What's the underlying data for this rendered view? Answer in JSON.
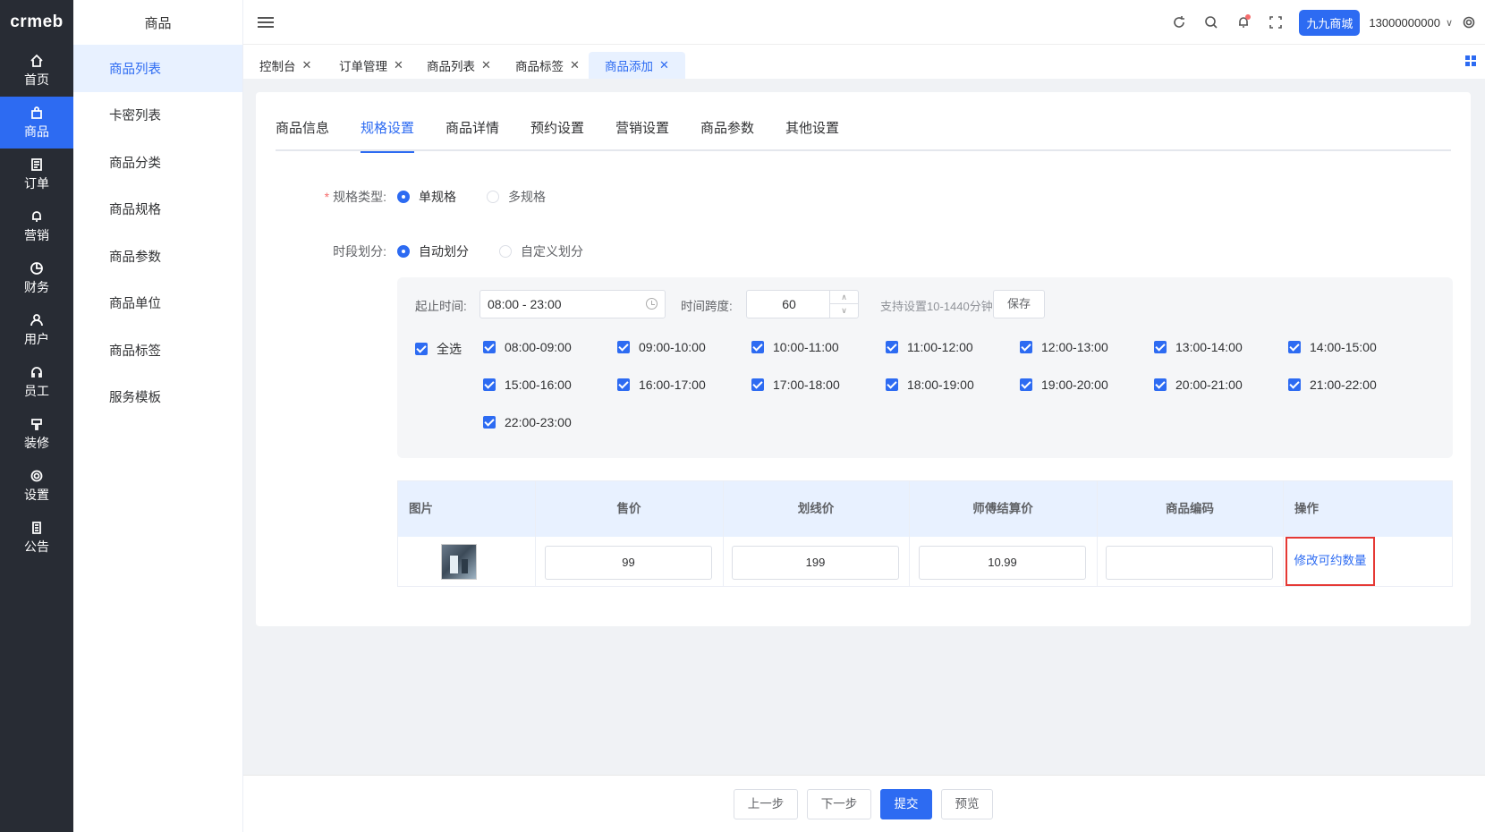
{
  "logo": "crmeb",
  "nav": [
    {
      "label": "首页",
      "icon": "home-icon"
    },
    {
      "label": "商品",
      "icon": "bag-icon"
    },
    {
      "label": "订单",
      "icon": "document-icon"
    },
    {
      "label": "营销",
      "icon": "bell-icon"
    },
    {
      "label": "财务",
      "icon": "pie-icon"
    },
    {
      "label": "用户",
      "icon": "user-icon"
    },
    {
      "label": "员工",
      "icon": "headset-icon"
    },
    {
      "label": "装修",
      "icon": "brush-icon"
    },
    {
      "label": "设置",
      "icon": "gear-icon"
    },
    {
      "label": "公告",
      "icon": "notice-icon"
    }
  ],
  "sidebar": {
    "title": "商品",
    "items": [
      "商品列表",
      "卡密列表",
      "商品分类",
      "商品规格",
      "商品参数",
      "商品单位",
      "商品标签",
      "服务模板"
    ]
  },
  "header": {
    "shop": "九九商城",
    "phone": "13000000000"
  },
  "tabs": [
    "控制台",
    "订单管理",
    "商品列表",
    "商品标签",
    "商品添加"
  ],
  "content_tabs": [
    "商品信息",
    "规格设置",
    "商品详情",
    "预约设置",
    "营销设置",
    "商品参数",
    "其他设置"
  ],
  "form": {
    "spec_type_label": "规格类型:",
    "spec_type_required": "*",
    "spec_options": [
      "单规格",
      "多规格"
    ],
    "period_label": "时段划分:",
    "period_options": [
      "自动划分",
      "自定义划分"
    ],
    "start_end_label": "起止时间:",
    "start_end_value": "08:00 - 23:00",
    "span_label": "时间跨度:",
    "span_value": "60",
    "span_hint": "支持设置10-1440分钟",
    "save": "保存",
    "select_all": "全选",
    "slots": [
      "08:00-09:00",
      "09:00-10:00",
      "10:00-11:00",
      "11:00-12:00",
      "12:00-13:00",
      "13:00-14:00",
      "14:00-15:00",
      "15:00-16:00",
      "16:00-17:00",
      "17:00-18:00",
      "18:00-19:00",
      "19:00-20:00",
      "20:00-21:00",
      "21:00-22:00",
      "22:00-23:00"
    ]
  },
  "table": {
    "headers": [
      "图片",
      "售价",
      "划线价",
      "师傅结算价",
      "商品编码",
      "操作"
    ],
    "row": {
      "price": "99",
      "line_price": "199",
      "settle_price": "10.99",
      "code": "",
      "action": "修改可约数量"
    }
  },
  "footer": {
    "prev": "上一步",
    "next": "下一步",
    "submit": "提交",
    "preview": "预览"
  },
  "colors": {
    "accent": "#2d6bf2",
    "nav_bg": "#282c34",
    "highlight": "#e53935"
  }
}
